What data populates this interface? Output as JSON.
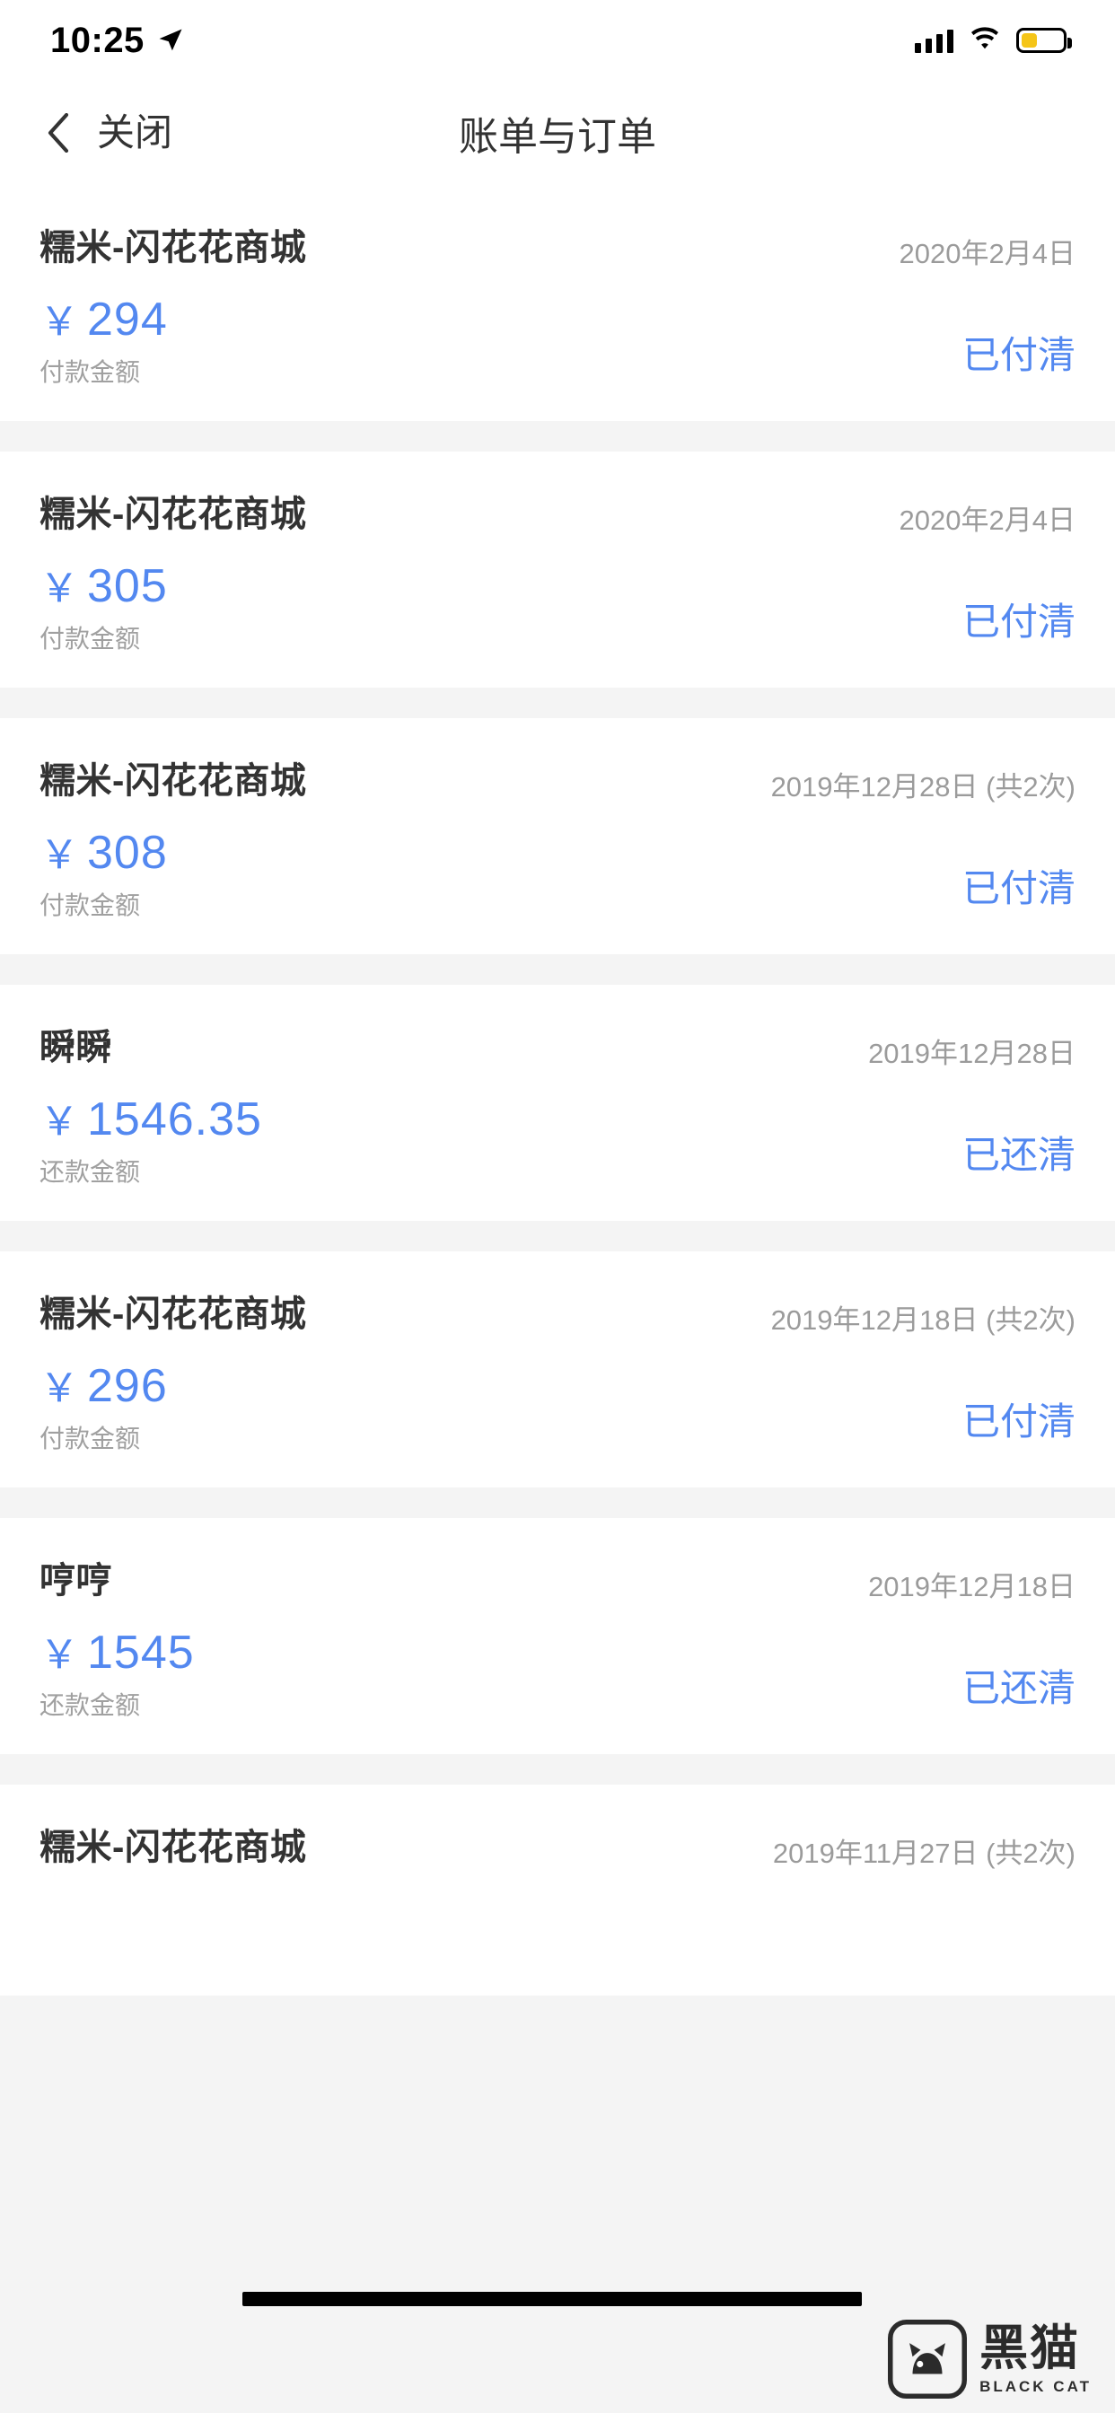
{
  "status_bar": {
    "time": "10:25",
    "location_icon": "location-arrow-icon",
    "signal_icon": "signal-bars-icon",
    "wifi_icon": "wifi-icon",
    "battery_icon": "battery-icon",
    "battery_level_percent": 34
  },
  "nav": {
    "back_icon": "chevron-left-icon",
    "close_label": "关闭",
    "title": "账单与订单"
  },
  "colors": {
    "accent_blue": "#5388f0",
    "primary_text": "#333333",
    "secondary_text": "#9b9b9b",
    "page_background": "#f4f4f4",
    "card_background": "#ffffff",
    "battery_fill": "#f5c518"
  },
  "transactions": [
    {
      "merchant": "糯米-闪花花商城",
      "date": "2020年2月4日",
      "currency": "￥",
      "amount": "294",
      "amount_label": "付款金额",
      "status": "已付清"
    },
    {
      "merchant": "糯米-闪花花商城",
      "date": "2020年2月4日",
      "currency": "￥",
      "amount": "305",
      "amount_label": "付款金额",
      "status": "已付清"
    },
    {
      "merchant": "糯米-闪花花商城",
      "date": "2019年12月28日 (共2次)",
      "currency": "￥",
      "amount": "308",
      "amount_label": "付款金额",
      "status": "已付清"
    },
    {
      "merchant": "瞬瞬",
      "date": "2019年12月28日",
      "currency": "￥",
      "amount": "1546.35",
      "amount_label": "还款金额",
      "status": "已还清"
    },
    {
      "merchant": "糯米-闪花花商城",
      "date": "2019年12月18日 (共2次)",
      "currency": "￥",
      "amount": "296",
      "amount_label": "付款金额",
      "status": "已付清"
    },
    {
      "merchant": "哼哼",
      "date": "2019年12月18日",
      "currency": "￥",
      "amount": "1545",
      "amount_label": "还款金额",
      "status": "已还清"
    },
    {
      "merchant": "糯米-闪花花商城",
      "date": "2019年11月27日 (共2次)",
      "currency": "￥",
      "amount": "",
      "amount_label": "",
      "status": ""
    }
  ],
  "watermark": {
    "logo_icon": "black-cat-logo-icon",
    "chinese": "黑猫",
    "english": "BLACK CAT"
  }
}
